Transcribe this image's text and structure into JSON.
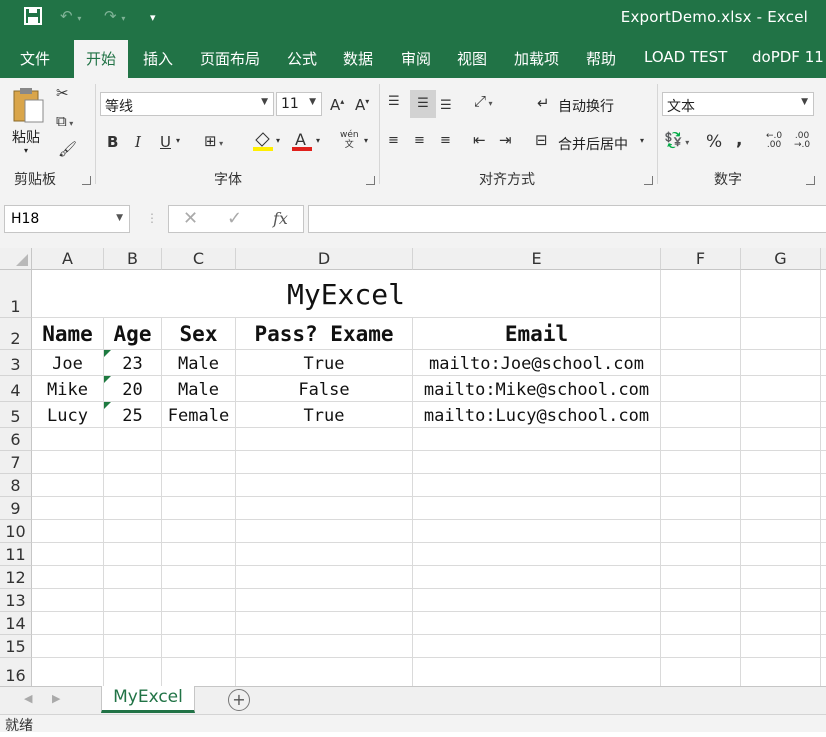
{
  "titlebar": {
    "title": "ExportDemo.xlsx  -  Excel",
    "save_icon": "save-icon",
    "undo_icon": "undo-icon",
    "redo_icon": "redo-icon",
    "customize_icon": "customize-quick-access-icon"
  },
  "tabs": [
    "文件",
    "开始",
    "插入",
    "页面布局",
    "公式",
    "数据",
    "审阅",
    "视图",
    "加载项",
    "帮助",
    "LOAD TEST",
    "doPDF 11"
  ],
  "active_tab": "开始",
  "ribbon": {
    "clipboard": {
      "paste": "粘贴",
      "label": "剪贴板"
    },
    "font": {
      "name": "等线",
      "size": "11",
      "label": "字体",
      "bold": "B",
      "italic": "I",
      "underline": "U",
      "phonetic": "wén"
    },
    "alignment": {
      "wrap": "自动换行",
      "merge": "合并后居中",
      "label": "对齐方式"
    },
    "number": {
      "format": "文本",
      "percent": "%",
      "comma": ",",
      "label": "数字"
    }
  },
  "formula_bar": {
    "name_box": "H18",
    "fx": "fx",
    "value": ""
  },
  "columns": [
    "A",
    "B",
    "C",
    "D",
    "E",
    "F",
    "G"
  ],
  "rows": [
    "1",
    "2",
    "3",
    "4",
    "5",
    "6",
    "7",
    "8",
    "9",
    "10",
    "11",
    "12",
    "13",
    "14",
    "15",
    "16"
  ],
  "sheet": {
    "title": "MyExcel",
    "headers": [
      "Name",
      "Age",
      "Sex",
      "Pass? Exame",
      "Email"
    ],
    "records": [
      [
        "Joe",
        "23",
        "Male",
        "True",
        "mailto:Joe@school.com"
      ],
      [
        "Mike",
        "20",
        "Male",
        "False",
        "mailto:Mike@school.com"
      ],
      [
        "Lucy",
        "25",
        "Female",
        "True",
        "mailto:Lucy@school.com"
      ]
    ]
  },
  "sheet_tab": "MyExcel",
  "status": "就绪",
  "colors": {
    "brand": "#217346",
    "error_indicator": "#1e7a40"
  }
}
